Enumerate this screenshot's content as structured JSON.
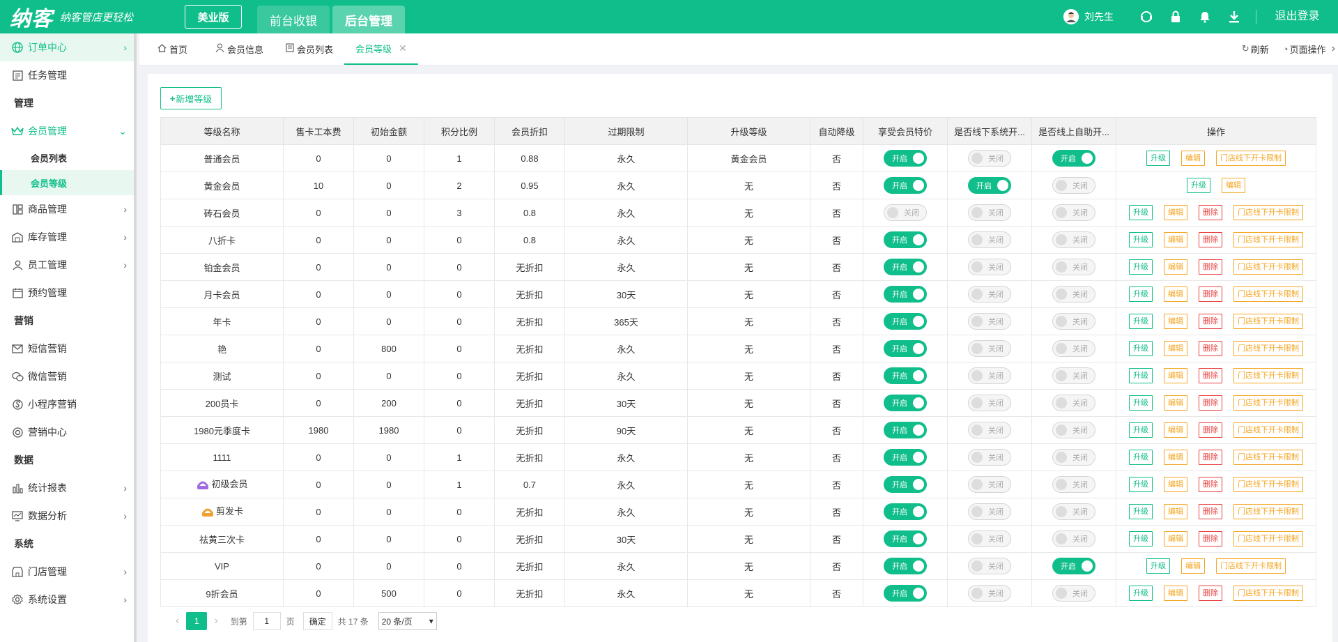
{
  "header": {
    "logo_main": "纳客",
    "logo_slogan": "纳客管店更轻松",
    "edition": "美业版",
    "tabs": [
      "前台收银",
      "后台管理"
    ],
    "user_name": "刘先生",
    "logout": "退出登录"
  },
  "sidebar": {
    "items": [
      {
        "label": "订单中心"
      },
      {
        "label": "任务管理"
      },
      {
        "group": "管理"
      },
      {
        "label": "会员管理"
      },
      {
        "sub": "会员列表"
      },
      {
        "sub": "会员等级"
      },
      {
        "label": "商品管理"
      },
      {
        "label": "库存管理"
      },
      {
        "label": "员工管理"
      },
      {
        "label": "预约管理"
      },
      {
        "group": "营销"
      },
      {
        "label": "短信营销"
      },
      {
        "label": "微信营销"
      },
      {
        "label": "小程序营销"
      },
      {
        "label": "营销中心"
      },
      {
        "group": "数据"
      },
      {
        "label": "统计报表"
      },
      {
        "label": "数据分析"
      },
      {
        "group": "系统"
      },
      {
        "label": "门店管理"
      },
      {
        "label": "系统设置"
      }
    ]
  },
  "tabbar": {
    "tabs": [
      "首页",
      "会员信息",
      "会员列表",
      "会员等级"
    ],
    "refresh": "刷新",
    "page_ops": "页面操作"
  },
  "toolbar": {
    "add_label": "新增等级"
  },
  "table": {
    "columns": [
      "等级名称",
      "售卡工本费",
      "初始金额",
      "积分比例",
      "会员折扣",
      "过期限制",
      "升级等级",
      "自动降级",
      "享受会员特价",
      "是否线下系统开...",
      "是否线上自助开...",
      "操作"
    ],
    "switch_on": "开启",
    "switch_off": "关闭",
    "op_labels": {
      "up": "升级",
      "edit": "编辑",
      "del": "删除",
      "limit": "门店线下开卡限制"
    },
    "rows": [
      {
        "name": "普通会员",
        "fee": "0",
        "init": "0",
        "ratio": "1",
        "disc": "0.88",
        "exp": "永久",
        "upg": "黄金会员",
        "down": "否",
        "s1": true,
        "s2": false,
        "s3": true,
        "ops": [
          "up",
          "edit",
          "limit"
        ]
      },
      {
        "name": "黄金会员",
        "fee": "10",
        "init": "0",
        "ratio": "2",
        "disc": "0.95",
        "exp": "永久",
        "upg": "无",
        "down": "否",
        "s1": true,
        "s2": true,
        "s3": false,
        "ops": [
          "up",
          "edit"
        ]
      },
      {
        "name": "砖石会员",
        "fee": "0",
        "init": "0",
        "ratio": "3",
        "disc": "0.8",
        "exp": "永久",
        "upg": "无",
        "down": "否",
        "s1": false,
        "s2": false,
        "s3": false,
        "ops": [
          "up",
          "edit",
          "del",
          "limit"
        ]
      },
      {
        "name": "八折卡",
        "fee": "0",
        "init": "0",
        "ratio": "0",
        "disc": "0.8",
        "exp": "永久",
        "upg": "无",
        "down": "否",
        "s1": true,
        "s2": false,
        "s3": false,
        "ops": [
          "up",
          "edit",
          "del",
          "limit"
        ]
      },
      {
        "name": "铂金会员",
        "fee": "0",
        "init": "0",
        "ratio": "0",
        "disc": "无折扣",
        "exp": "永久",
        "upg": "无",
        "down": "否",
        "s1": true,
        "s2": false,
        "s3": false,
        "ops": [
          "up",
          "edit",
          "del",
          "limit"
        ]
      },
      {
        "name": "月卡会员",
        "fee": "0",
        "init": "0",
        "ratio": "0",
        "disc": "无折扣",
        "exp": "30天",
        "upg": "无",
        "down": "否",
        "s1": true,
        "s2": false,
        "s3": false,
        "ops": [
          "up",
          "edit",
          "del",
          "limit"
        ]
      },
      {
        "name": "年卡",
        "fee": "0",
        "init": "0",
        "ratio": "0",
        "disc": "无折扣",
        "exp": "365天",
        "upg": "无",
        "down": "否",
        "s1": true,
        "s2": false,
        "s3": false,
        "ops": [
          "up",
          "edit",
          "del",
          "limit"
        ]
      },
      {
        "name": "艳",
        "fee": "0",
        "init": "800",
        "ratio": "0",
        "disc": "无折扣",
        "exp": "永久",
        "upg": "无",
        "down": "否",
        "s1": true,
        "s2": false,
        "s3": false,
        "ops": [
          "up",
          "edit",
          "del",
          "limit"
        ]
      },
      {
        "name": "测试",
        "fee": "0",
        "init": "0",
        "ratio": "0",
        "disc": "无折扣",
        "exp": "永久",
        "upg": "无",
        "down": "否",
        "s1": true,
        "s2": false,
        "s3": false,
        "ops": [
          "up",
          "edit",
          "del",
          "limit"
        ]
      },
      {
        "name": "200员卡",
        "fee": "0",
        "init": "200",
        "ratio": "0",
        "disc": "无折扣",
        "exp": "30天",
        "upg": "无",
        "down": "否",
        "s1": true,
        "s2": false,
        "s3": false,
        "ops": [
          "up",
          "edit",
          "del",
          "limit"
        ]
      },
      {
        "name": "1980元季度卡",
        "fee": "1980",
        "init": "1980",
        "ratio": "0",
        "disc": "无折扣",
        "exp": "90天",
        "upg": "无",
        "down": "否",
        "s1": true,
        "s2": false,
        "s3": false,
        "ops": [
          "up",
          "edit",
          "del",
          "limit"
        ]
      },
      {
        "name": "1111",
        "fee": "0",
        "init": "0",
        "ratio": "1",
        "disc": "无折扣",
        "exp": "永久",
        "upg": "无",
        "down": "否",
        "s1": true,
        "s2": false,
        "s3": false,
        "ops": [
          "up",
          "edit",
          "del",
          "limit"
        ]
      },
      {
        "name": "初级会员",
        "badge": "purple",
        "fee": "0",
        "init": "0",
        "ratio": "1",
        "disc": "0.7",
        "exp": "永久",
        "upg": "无",
        "down": "否",
        "s1": true,
        "s2": false,
        "s3": false,
        "ops": [
          "up",
          "edit",
          "del",
          "limit"
        ]
      },
      {
        "name": "剪发卡",
        "badge": "orange",
        "fee": "0",
        "init": "0",
        "ratio": "0",
        "disc": "无折扣",
        "exp": "永久",
        "upg": "无",
        "down": "否",
        "s1": true,
        "s2": false,
        "s3": false,
        "ops": [
          "up",
          "edit",
          "del",
          "limit"
        ]
      },
      {
        "name": "祛黄三次卡",
        "fee": "0",
        "init": "0",
        "ratio": "0",
        "disc": "无折扣",
        "exp": "30天",
        "upg": "无",
        "down": "否",
        "s1": true,
        "s2": false,
        "s3": false,
        "ops": [
          "up",
          "edit",
          "del",
          "limit"
        ]
      },
      {
        "name": "VIP",
        "fee": "0",
        "init": "0",
        "ratio": "0",
        "disc": "无折扣",
        "exp": "永久",
        "upg": "无",
        "down": "否",
        "s1": true,
        "s2": false,
        "s3": true,
        "ops": [
          "up",
          "edit",
          "limit"
        ]
      },
      {
        "name": "9折会员",
        "fee": "0",
        "init": "500",
        "ratio": "0",
        "disc": "无折扣",
        "exp": "永久",
        "upg": "无",
        "down": "否",
        "s1": true,
        "s2": false,
        "s3": false,
        "ops": [
          "up",
          "edit",
          "del",
          "limit"
        ]
      }
    ]
  },
  "pager": {
    "current": "1",
    "goto": "到第",
    "page_input": "1",
    "page_unit": "页",
    "confirm": "确定",
    "total": "共 17 条",
    "page_size": "20 条/页"
  },
  "colors": {
    "primary": "#0fbe8a",
    "edit": "#f5a623",
    "delete": "#e94040"
  }
}
